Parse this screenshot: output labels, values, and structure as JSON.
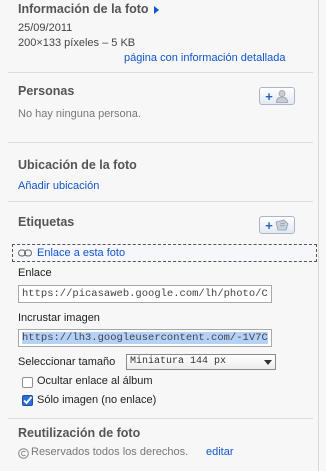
{
  "info": {
    "title": "Información de la foto",
    "date": "25/09/2011",
    "size": "200×133 píxeles – 5 KB",
    "details_link": "página con información detallada"
  },
  "people": {
    "title": "Personas",
    "empty": "No hay ninguna persona."
  },
  "location": {
    "title": "Ubicación de la foto",
    "add_link": "Añadir ubicación"
  },
  "tags": {
    "title": "Etiquetas"
  },
  "embed": {
    "link_toggle": "Enlace a esta foto",
    "link_label": "Enlace",
    "link_value": "https://picasaweb.google.com/lh/photo/C",
    "embed_label": "Incrustar imagen",
    "embed_value": "https://lh3.googleusercontent.com/-1V7C",
    "size_label": "Seleccionar tamaño",
    "size_value": "Miniatura 144 px",
    "hide_album_link": "Ocultar enlace al álbum",
    "hide_album_checked": false,
    "image_only": "Sólo imagen (no enlace)",
    "image_only_checked": true
  },
  "reuse": {
    "title": "Reutilización de foto",
    "rights": "Reservados todos los derechos.",
    "edit_link": "editar"
  }
}
